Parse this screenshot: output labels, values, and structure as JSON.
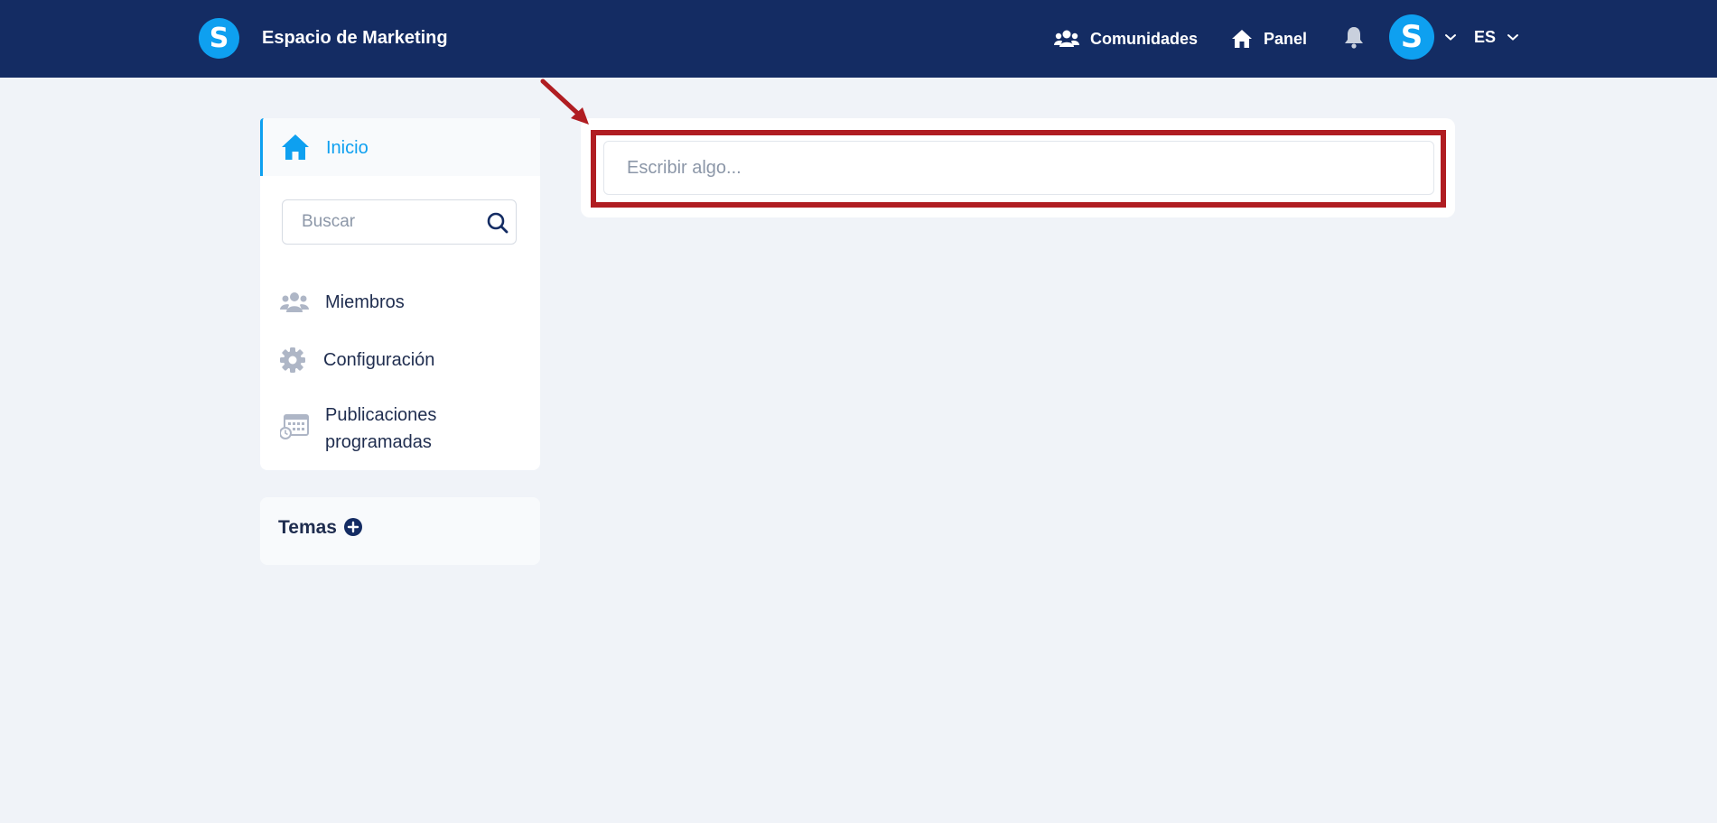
{
  "header": {
    "logo_letter": "S",
    "brand_name": "Espacio de Marketing",
    "nav": {
      "communities": "Comunidades",
      "panel": "Panel"
    },
    "user_initial": "S",
    "language": "ES"
  },
  "sidebar": {
    "home_label": "Inicio",
    "search_placeholder": "Buscar",
    "items": [
      {
        "label": "Miembros",
        "icon": "members-icon"
      },
      {
        "label": "Configuración",
        "icon": "gear-icon"
      },
      {
        "label": "Publicaciones programadas",
        "icon": "calendar-clock-icon"
      }
    ],
    "topics_label": "Temas"
  },
  "composer": {
    "placeholder": "Escribir algo..."
  },
  "colors": {
    "navbar": "#142c63",
    "accent": "#0ea0f0",
    "highlight": "#b01d22",
    "background": "#f0f3f8",
    "icon_muted": "#aeb6c6"
  }
}
